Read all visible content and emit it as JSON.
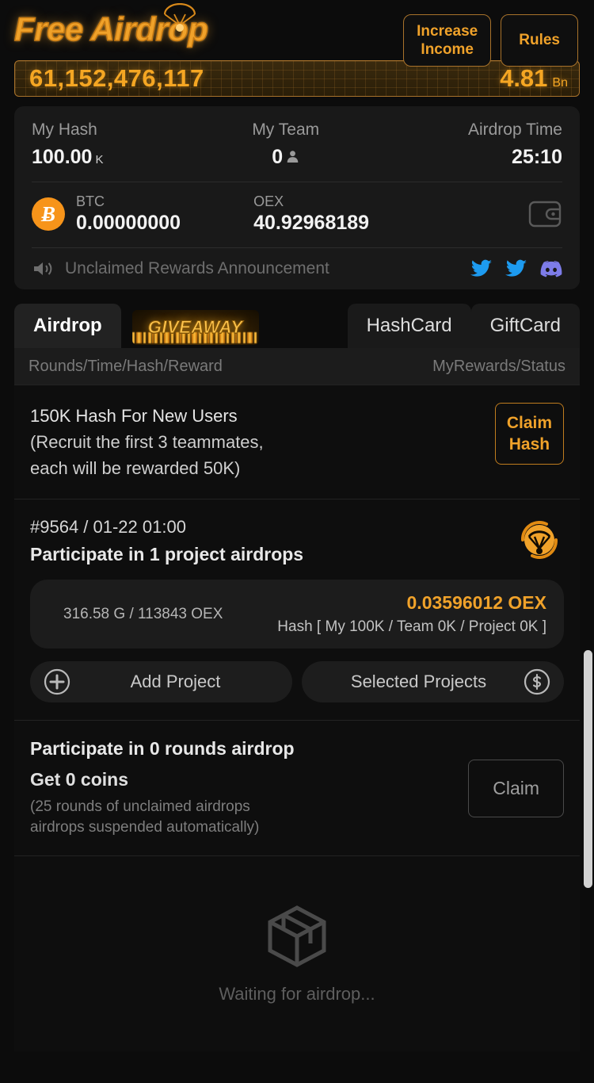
{
  "header": {
    "logo": "Free Airdrop",
    "logo_icon": "parachute-icon",
    "increase_income": "Increase\nIncome",
    "increase_income_line1": "Increase",
    "increase_income_line2": "Income",
    "rules": "Rules"
  },
  "ticker": {
    "total": "61,152,476,117",
    "rate": "4.81",
    "unit": "Bn"
  },
  "stats": {
    "my_hash_label": "My Hash",
    "my_hash_value": "100.00",
    "my_hash_unit": "K",
    "my_team_label": "My Team",
    "my_team_value": "0",
    "airdrop_time_label": "Airdrop Time",
    "airdrop_time_value": "25:10",
    "btc_name": "BTC",
    "btc_amount": "0.00000000",
    "btc_symbol": "Ƀ",
    "oex_name": "OEX",
    "oex_amount": "40.92968189",
    "announcement": "Unclaimed Rewards Announcement",
    "socials": [
      "twitter-icon",
      "twitter-icon",
      "discord-icon"
    ]
  },
  "tabs": [
    {
      "label": "Airdrop",
      "active": true
    },
    {
      "label": "GIVEAWAY",
      "active": false
    },
    {
      "label": "HashCard",
      "active": false
    },
    {
      "label": "GiftCard",
      "active": false
    }
  ],
  "subheader": {
    "left": "Rounds/Time/Hash/Reward",
    "right": "MyRewards/Status"
  },
  "promo": {
    "line1": "150K Hash For New Users",
    "line2": "(Recruit the first 3 teammates,",
    "line3": "each will be rewarded 50K)",
    "button_line1": "Claim",
    "button_line2": "Hash"
  },
  "round": {
    "id_time": "#9564 / 01-22 01:00",
    "description": "Participate in 1 project airdrops",
    "icon": "airdrop-parachute-icon",
    "reward_left": "316.58 G / 113843 OEX",
    "reward_amount": "0.03596012 OEX",
    "reward_hash": "Hash [ My 100K / Team 0K / Project 0K ]",
    "add_project": "Add Project",
    "add_project_icon": "plus-circle-icon",
    "selected_projects": "Selected Projects",
    "selected_projects_icon": "dollar-circle-icon"
  },
  "claim": {
    "line1": "Participate in 0 rounds airdrop",
    "line2": "Get 0 coins",
    "note_line1": "(25 rounds of unclaimed airdrops",
    "note_line2": "airdrops suspended automatically)",
    "button": "Claim"
  },
  "empty": {
    "icon": "cube-box-icon",
    "text": "Waiting for airdrop..."
  },
  "colors": {
    "accent": "#f0a22a",
    "ticker_text": "#f5a623",
    "bg": "#0c0c0c",
    "card_bg": "#191919",
    "btc_orange": "#f7941a",
    "twitter_blue": "#1d9bf0",
    "discord_purple": "#7d7ce8"
  }
}
